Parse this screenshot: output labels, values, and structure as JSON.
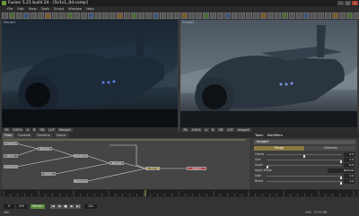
{
  "window": {
    "title": "Fusion 5.21 build 24 - [Sc1s1_0d.comp]",
    "controls": [
      "–",
      "□",
      "×"
    ]
  },
  "menubar": [
    "File",
    "Edit",
    "View",
    "Tools",
    "Script",
    "Window",
    "Help"
  ],
  "viewers": {
    "left": {
      "label": "Merge1",
      "buttons": [
        "Fit",
        "100%",
        "A",
        "B",
        "3D",
        "LUT",
        "Merge1"
      ]
    },
    "right": {
      "label": "Image2",
      "buttons": [
        "Fit",
        "100%",
        "A",
        "B",
        "3D",
        "LUT",
        "Image2"
      ]
    }
  },
  "tabs": [
    "Flow",
    "Console",
    "Timeline",
    "Spline"
  ],
  "flow_nodes": [
    {
      "label": "Loader1",
      "selected": false,
      "red": false
    },
    {
      "label": "Merge1",
      "selected": false,
      "red": false
    },
    {
      "label": "Blur1",
      "selected": false,
      "red": false
    },
    {
      "label": "Transform1",
      "selected": false,
      "red": false
    },
    {
      "label": "ColorCorrector1",
      "selected": false,
      "red": false
    },
    {
      "label": "Merge2",
      "selected": false,
      "red": false
    },
    {
      "label": "Mask1",
      "selected": false,
      "red": false
    },
    {
      "label": "Background1",
      "selected": false,
      "red": false
    },
    {
      "label": "Merge3",
      "selected": true,
      "red": false
    },
    {
      "label": "Saver1",
      "selected": false,
      "red": true
    }
  ],
  "inspector": {
    "tabs": [
      "Tools",
      "Modifiers"
    ],
    "tool": "Image2",
    "buttons": [
      "Merge",
      "Channels"
    ],
    "params": [
      {
        "label": "Center",
        "value": "0.5"
      },
      {
        "label": "Size",
        "value": "1.0"
      },
      {
        "label": "Angle",
        "value": "0.0"
      },
      {
        "label": "Apply Mode",
        "value": "Normal"
      },
      {
        "label": "Gain",
        "value": "1.0"
      },
      {
        "label": "Blend",
        "value": "1.0"
      }
    ]
  },
  "transport": {
    "start": "0",
    "end": "250",
    "current": "102",
    "render_label": "Render",
    "buttons": [
      "|◀",
      "◀",
      "■",
      "▶",
      "▶|"
    ],
    "status": "29% - 5179 MB",
    "state": "Idle"
  }
}
